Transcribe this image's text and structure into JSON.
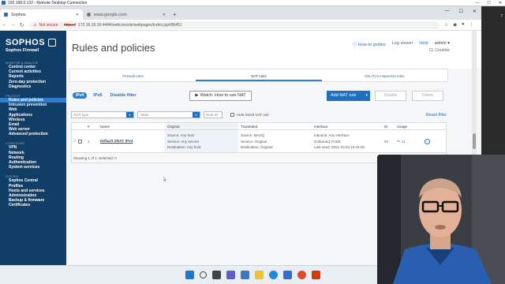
{
  "rdp": {
    "title": "192.168.0.132 - Remote Desktop Connection",
    "controls": [
      "—",
      "☐",
      "✕"
    ]
  },
  "browser": {
    "tabs": [
      {
        "label": "Sophos",
        "active": true
      },
      {
        "label": "www.google.com",
        "active": false
      }
    ],
    "new_tab": "+",
    "address": {
      "security_label": "Not secure",
      "protocol": "https://",
      "url": "172.16.16.16:4444/webconsole/webpages/index.jsp#96451"
    },
    "window_controls": [
      "—",
      "☐",
      "✕"
    ]
  },
  "sidebar": {
    "logo": "SOPHOS",
    "product": "Sophos Firewall",
    "groups": [
      {
        "label": "MONITOR & ANALYZE",
        "items": [
          "Control center",
          "Current activities",
          "Reports",
          "Zero-day protection",
          "Diagnostics"
        ]
      },
      {
        "label": "PROTECT",
        "items": [
          "Rules and policies",
          "Intrusion prevention",
          "Web",
          "Applications",
          "Wireless",
          "Email",
          "Web server",
          "Advanced protection"
        ]
      },
      {
        "label": "CONFIGURE",
        "items": [
          "VPN",
          "Network",
          "Routing",
          "Authentication",
          "System services"
        ]
      },
      {
        "label": "SYSTEM",
        "items": [
          "Sophos Central",
          "Profiles",
          "Hosts and services",
          "Administration",
          "Backup & firmware",
          "Certificates"
        ]
      }
    ],
    "active_item": "Rules and policies"
  },
  "header": {
    "title": "Rules and policies",
    "links": [
      "How-to guides",
      "Log viewer",
      "Help"
    ],
    "user": "admin ▾",
    "user_sub": "CL Creative"
  },
  "subtabs": [
    {
      "label": "Firewall rules",
      "active": false
    },
    {
      "label": "NAT rules",
      "active": true
    },
    {
      "label": "SSL/TLS inspection rules",
      "active": false
    }
  ],
  "toolbar": {
    "ipv4": "IPv4",
    "ipv6": "IPv6",
    "disable_filter": "Disable filter",
    "watch": "Watch: How to use NAT",
    "add_nat": "Add NAT rule",
    "disable": "Disable",
    "delete": "Delete"
  },
  "filters": {
    "nat_type": "NAT type",
    "state": "State",
    "rule_id": "Rule ID",
    "hide_linked": "Hide linked NAT rule",
    "reset": "Reset filter"
  },
  "table": {
    "columns": [
      "#",
      "Name",
      "Original",
      "Translated",
      "Interface",
      "ID",
      "Usage"
    ],
    "rows": [
      {
        "grip": "⠿",
        "num": "1",
        "name": "Default SNAT IPv4",
        "original": [
          "Source: Any host",
          "Service: Any service",
          "Destination: Any host"
        ],
        "translated": [
          "Source: MASQ",
          "Service: Original",
          "Destination: Original"
        ],
        "interface": [
          "Inbound: Any interface",
          "Outbound: PortB",
          "Last used: 2021-10-04 10:22:28"
        ],
        "id": "#2",
        "usage": "11"
      }
    ],
    "footer": "Showing 1 of 1. Selected: 0"
  },
  "colors": {
    "sidebar_bg": "#103e66",
    "accent": "#2f7dcb",
    "primary_button": "#1d6fc1"
  }
}
